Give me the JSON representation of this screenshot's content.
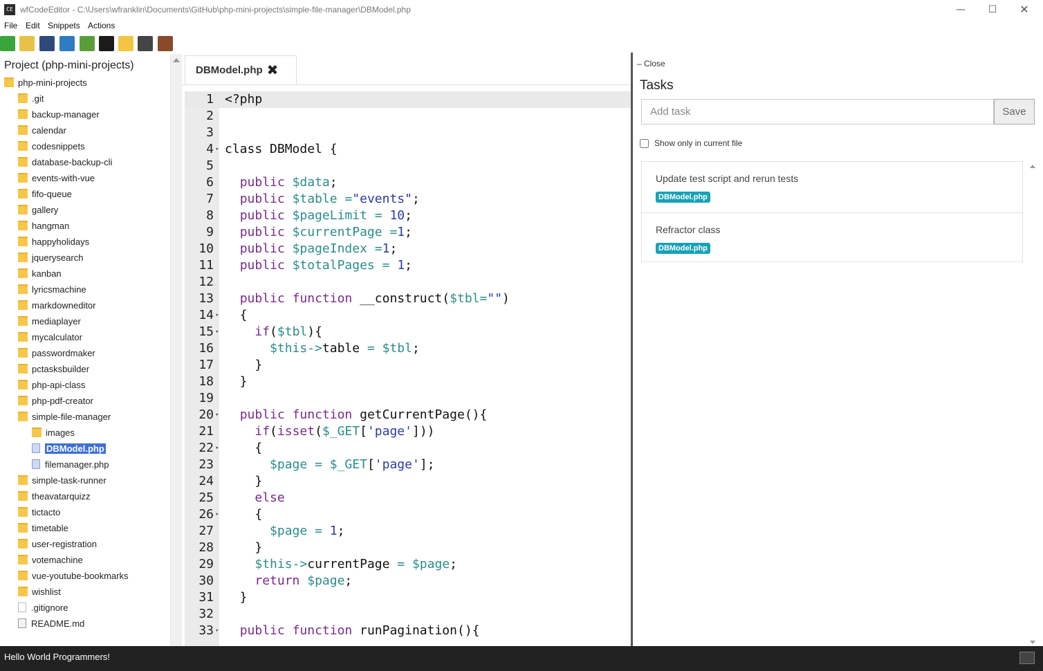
{
  "window": {
    "title": "wfCodeEditor - C:\\Users\\wfranklin\\Documents\\GitHub\\php-mini-projects\\simple-file-manager\\DBModel.php",
    "minimize": "—",
    "maximize": "☐",
    "close": "✕"
  },
  "menu": [
    "File",
    "Edit",
    "Snippets",
    "Actions"
  ],
  "toolbar": [
    {
      "name": "new-file-icon",
      "color": "#3aa53a"
    },
    {
      "name": "open-folder-icon",
      "color": "#e8c14a"
    },
    {
      "name": "save-icon",
      "color": "#2d4a7a"
    },
    {
      "name": "globe-icon",
      "color": "#2e7bc4"
    },
    {
      "name": "layout-icon",
      "color": "#5a9e3a"
    },
    {
      "name": "terminal-icon",
      "color": "#1b1b1b"
    },
    {
      "name": "note-icon",
      "color": "#f4c542"
    },
    {
      "name": "preview-icon",
      "color": "#444444"
    },
    {
      "name": "books-icon",
      "color": "#8a4a2a"
    }
  ],
  "project": {
    "title": "Project (php-mini-projects)",
    "tree": [
      {
        "label": "php-mini-projects",
        "type": "folder",
        "depth": 0
      },
      {
        "label": ".git",
        "type": "folder",
        "depth": 1
      },
      {
        "label": "backup-manager",
        "type": "folder",
        "depth": 1
      },
      {
        "label": "calendar",
        "type": "folder",
        "depth": 1
      },
      {
        "label": "codesnippets",
        "type": "folder",
        "depth": 1
      },
      {
        "label": "database-backup-cli",
        "type": "folder",
        "depth": 1
      },
      {
        "label": "events-with-vue",
        "type": "folder",
        "depth": 1
      },
      {
        "label": "fifo-queue",
        "type": "folder",
        "depth": 1
      },
      {
        "label": "gallery",
        "type": "folder",
        "depth": 1
      },
      {
        "label": "hangman",
        "type": "folder",
        "depth": 1
      },
      {
        "label": "happyholidays",
        "type": "folder",
        "depth": 1
      },
      {
        "label": "jquerysearch",
        "type": "folder",
        "depth": 1
      },
      {
        "label": "kanban",
        "type": "folder",
        "depth": 1
      },
      {
        "label": "lyricsmachine",
        "type": "folder",
        "depth": 1
      },
      {
        "label": "markdowneditor",
        "type": "folder",
        "depth": 1
      },
      {
        "label": "mediaplayer",
        "type": "folder",
        "depth": 1
      },
      {
        "label": "mycalculator",
        "type": "folder",
        "depth": 1
      },
      {
        "label": "passwordmaker",
        "type": "folder",
        "depth": 1
      },
      {
        "label": "pctasksbuilder",
        "type": "folder",
        "depth": 1
      },
      {
        "label": "php-api-class",
        "type": "folder",
        "depth": 1
      },
      {
        "label": "php-pdf-creator",
        "type": "folder",
        "depth": 1
      },
      {
        "label": "simple-file-manager",
        "type": "folder",
        "depth": 1
      },
      {
        "label": "images",
        "type": "folder",
        "depth": 2
      },
      {
        "label": "DBModel.php",
        "type": "php",
        "depth": 2,
        "selected": true
      },
      {
        "label": "filemanager.php",
        "type": "php",
        "depth": 2
      },
      {
        "label": "simple-task-runner",
        "type": "folder",
        "depth": 1
      },
      {
        "label": "theavatarquizz",
        "type": "folder",
        "depth": 1
      },
      {
        "label": "tictacto",
        "type": "folder",
        "depth": 1
      },
      {
        "label": "timetable",
        "type": "folder",
        "depth": 1
      },
      {
        "label": "user-registration",
        "type": "folder",
        "depth": 1
      },
      {
        "label": "votemachine",
        "type": "folder",
        "depth": 1
      },
      {
        "label": "vue-youtube-bookmarks",
        "type": "folder",
        "depth": 1
      },
      {
        "label": "wishlist",
        "type": "folder",
        "depth": 1
      },
      {
        "label": ".gitignore",
        "type": "plain",
        "depth": 1
      },
      {
        "label": "README.md",
        "type": "md",
        "depth": 1
      }
    ]
  },
  "editor": {
    "tab_label": "DBModel.php",
    "tab_close": "✖",
    "lines": [
      {
        "n": "1",
        "fold": false,
        "active": true,
        "tokens": [
          [
            "p",
            "<?php"
          ]
        ]
      },
      {
        "n": "2",
        "fold": false,
        "tokens": []
      },
      {
        "n": "3",
        "fold": false,
        "tokens": []
      },
      {
        "n": "4",
        "fold": true,
        "tokens": [
          [
            "p",
            "class DBModel {"
          ]
        ]
      },
      {
        "n": "5",
        "fold": false,
        "tokens": []
      },
      {
        "n": "6",
        "fold": false,
        "tokens": [
          [
            "p",
            "  "
          ],
          [
            "kw",
            "public"
          ],
          [
            "p",
            " "
          ],
          [
            "var",
            "$data"
          ],
          [
            "p",
            ";"
          ]
        ]
      },
      {
        "n": "7",
        "fold": false,
        "tokens": [
          [
            "p",
            "  "
          ],
          [
            "kw",
            "public"
          ],
          [
            "p",
            " "
          ],
          [
            "var",
            "$table"
          ],
          [
            "p",
            " "
          ],
          [
            "op",
            "="
          ],
          [
            "str",
            "\"events\""
          ],
          [
            "p",
            ";"
          ]
        ]
      },
      {
        "n": "8",
        "fold": false,
        "tokens": [
          [
            "p",
            "  "
          ],
          [
            "kw",
            "public"
          ],
          [
            "p",
            " "
          ],
          [
            "var",
            "$pageLimit"
          ],
          [
            "p",
            " "
          ],
          [
            "op",
            "="
          ],
          [
            "p",
            " "
          ],
          [
            "num",
            "10"
          ],
          [
            "p",
            ";"
          ]
        ]
      },
      {
        "n": "9",
        "fold": false,
        "tokens": [
          [
            "p",
            "  "
          ],
          [
            "kw",
            "public"
          ],
          [
            "p",
            " "
          ],
          [
            "var",
            "$currentPage"
          ],
          [
            "p",
            " "
          ],
          [
            "op",
            "="
          ],
          [
            "num",
            "1"
          ],
          [
            "p",
            ";"
          ]
        ]
      },
      {
        "n": "10",
        "fold": false,
        "tokens": [
          [
            "p",
            "  "
          ],
          [
            "kw",
            "public"
          ],
          [
            "p",
            " "
          ],
          [
            "var",
            "$pageIndex"
          ],
          [
            "p",
            " "
          ],
          [
            "op",
            "="
          ],
          [
            "num",
            "1"
          ],
          [
            "p",
            ";"
          ]
        ]
      },
      {
        "n": "11",
        "fold": false,
        "tokens": [
          [
            "p",
            "  "
          ],
          [
            "kw",
            "public"
          ],
          [
            "p",
            " "
          ],
          [
            "var",
            "$totalPages"
          ],
          [
            "p",
            " "
          ],
          [
            "op",
            "="
          ],
          [
            "p",
            " "
          ],
          [
            "num",
            "1"
          ],
          [
            "p",
            ";"
          ]
        ]
      },
      {
        "n": "12",
        "fold": false,
        "tokens": []
      },
      {
        "n": "13",
        "fold": false,
        "tokens": [
          [
            "p",
            "  "
          ],
          [
            "kw",
            "public"
          ],
          [
            "p",
            " "
          ],
          [
            "kw",
            "function"
          ],
          [
            "p",
            " __construct("
          ],
          [
            "var",
            "$tbl"
          ],
          [
            "op",
            "="
          ],
          [
            "str",
            "\"\""
          ],
          [
            "p",
            ")"
          ]
        ]
      },
      {
        "n": "14",
        "fold": true,
        "tokens": [
          [
            "p",
            "  {"
          ]
        ]
      },
      {
        "n": "15",
        "fold": true,
        "tokens": [
          [
            "p",
            "    "
          ],
          [
            "kw",
            "if"
          ],
          [
            "p",
            "("
          ],
          [
            "var",
            "$tbl"
          ],
          [
            "p",
            "){"
          ]
        ]
      },
      {
        "n": "16",
        "fold": false,
        "tokens": [
          [
            "p",
            "      "
          ],
          [
            "var",
            "$this"
          ],
          [
            "op",
            "->"
          ],
          [
            "p",
            "table "
          ],
          [
            "op",
            "="
          ],
          [
            "p",
            " "
          ],
          [
            "var",
            "$tbl"
          ],
          [
            "p",
            ";"
          ]
        ]
      },
      {
        "n": "17",
        "fold": false,
        "tokens": [
          [
            "p",
            "    }"
          ]
        ]
      },
      {
        "n": "18",
        "fold": false,
        "tokens": [
          [
            "p",
            "  }"
          ]
        ]
      },
      {
        "n": "19",
        "fold": false,
        "tokens": []
      },
      {
        "n": "20",
        "fold": true,
        "tokens": [
          [
            "p",
            "  "
          ],
          [
            "kw",
            "public"
          ],
          [
            "p",
            " "
          ],
          [
            "kw",
            "function"
          ],
          [
            "p",
            " getCurrentPage(){"
          ]
        ]
      },
      {
        "n": "21",
        "fold": false,
        "tokens": [
          [
            "p",
            "    "
          ],
          [
            "kw",
            "if"
          ],
          [
            "p",
            "("
          ],
          [
            "kw",
            "isset"
          ],
          [
            "p",
            "("
          ],
          [
            "var",
            "$_GET"
          ],
          [
            "p",
            "["
          ],
          [
            "str",
            "'page'"
          ],
          [
            "p",
            "]))"
          ]
        ]
      },
      {
        "n": "22",
        "fold": true,
        "tokens": [
          [
            "p",
            "    {"
          ]
        ]
      },
      {
        "n": "23",
        "fold": false,
        "tokens": [
          [
            "p",
            "      "
          ],
          [
            "var",
            "$page"
          ],
          [
            "p",
            " "
          ],
          [
            "op",
            "="
          ],
          [
            "p",
            " "
          ],
          [
            "var",
            "$_GET"
          ],
          [
            "p",
            "["
          ],
          [
            "str",
            "'page'"
          ],
          [
            "p",
            "];"
          ]
        ]
      },
      {
        "n": "24",
        "fold": false,
        "tokens": [
          [
            "p",
            "    }"
          ]
        ]
      },
      {
        "n": "25",
        "fold": false,
        "tokens": [
          [
            "p",
            "    "
          ],
          [
            "kw",
            "else"
          ]
        ]
      },
      {
        "n": "26",
        "fold": true,
        "tokens": [
          [
            "p",
            "    {"
          ]
        ]
      },
      {
        "n": "27",
        "fold": false,
        "tokens": [
          [
            "p",
            "      "
          ],
          [
            "var",
            "$page"
          ],
          [
            "p",
            " "
          ],
          [
            "op",
            "="
          ],
          [
            "p",
            " "
          ],
          [
            "num",
            "1"
          ],
          [
            "p",
            ";"
          ]
        ]
      },
      {
        "n": "28",
        "fold": false,
        "tokens": [
          [
            "p",
            "    }"
          ]
        ]
      },
      {
        "n": "29",
        "fold": false,
        "tokens": [
          [
            "p",
            "    "
          ],
          [
            "var",
            "$this"
          ],
          [
            "op",
            "->"
          ],
          [
            "p",
            "currentPage "
          ],
          [
            "op",
            "="
          ],
          [
            "p",
            " "
          ],
          [
            "var",
            "$page"
          ],
          [
            "p",
            ";"
          ]
        ]
      },
      {
        "n": "30",
        "fold": false,
        "tokens": [
          [
            "p",
            "    "
          ],
          [
            "kw",
            "return"
          ],
          [
            "p",
            " "
          ],
          [
            "var",
            "$page"
          ],
          [
            "p",
            ";"
          ]
        ]
      },
      {
        "n": "31",
        "fold": false,
        "tokens": [
          [
            "p",
            "  }"
          ]
        ]
      },
      {
        "n": "32",
        "fold": false,
        "tokens": []
      },
      {
        "n": "33",
        "fold": true,
        "tokens": [
          [
            "p",
            "  "
          ],
          [
            "kw",
            "public"
          ],
          [
            "p",
            " "
          ],
          [
            "kw",
            "function"
          ],
          [
            "p",
            " runPagination(){"
          ]
        ]
      }
    ]
  },
  "tasks": {
    "close_label": "– Close",
    "title": "Tasks",
    "input_placeholder": "Add task",
    "save_label": "Save",
    "show_only_label": "Show only in current file",
    "items": [
      {
        "text": "Update test script and rerun tests",
        "badge": "DBModel.php"
      },
      {
        "text": "Refractor class",
        "badge": "DBModel.php"
      }
    ]
  },
  "status": {
    "text": "Hello World Programmers!"
  }
}
